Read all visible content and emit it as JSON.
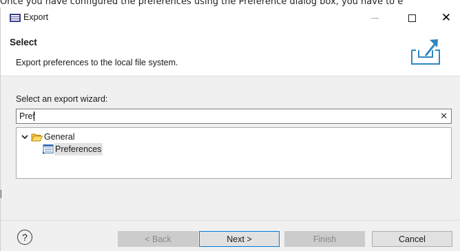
{
  "doc_caption": "Once you have configured the preferences using the Preference dialog box, you have to e",
  "window": {
    "title": "Export",
    "minimize_glyph": "—",
    "close_glyph": "✕"
  },
  "header": {
    "title": "Select",
    "description": "Export preferences to the local file system."
  },
  "wizard": {
    "label": "Select an export wizard:",
    "filter_value": "Pref",
    "clear_glyph": "✕"
  },
  "tree": {
    "items": [
      {
        "label": "General",
        "expanded": true,
        "icon": "folder-open-icon"
      },
      {
        "label": "Preferences",
        "selected": true,
        "icon": "preferences-icon"
      }
    ]
  },
  "buttons": {
    "help": "?",
    "back": "< Back",
    "next": "Next >",
    "finish": "Finish",
    "cancel": "Cancel"
  },
  "colors": {
    "accent": "#0078d7",
    "dialog_bg": "#f0f0f0",
    "banner_icon": "#2e86c1",
    "selection": "#e2e2e2"
  }
}
